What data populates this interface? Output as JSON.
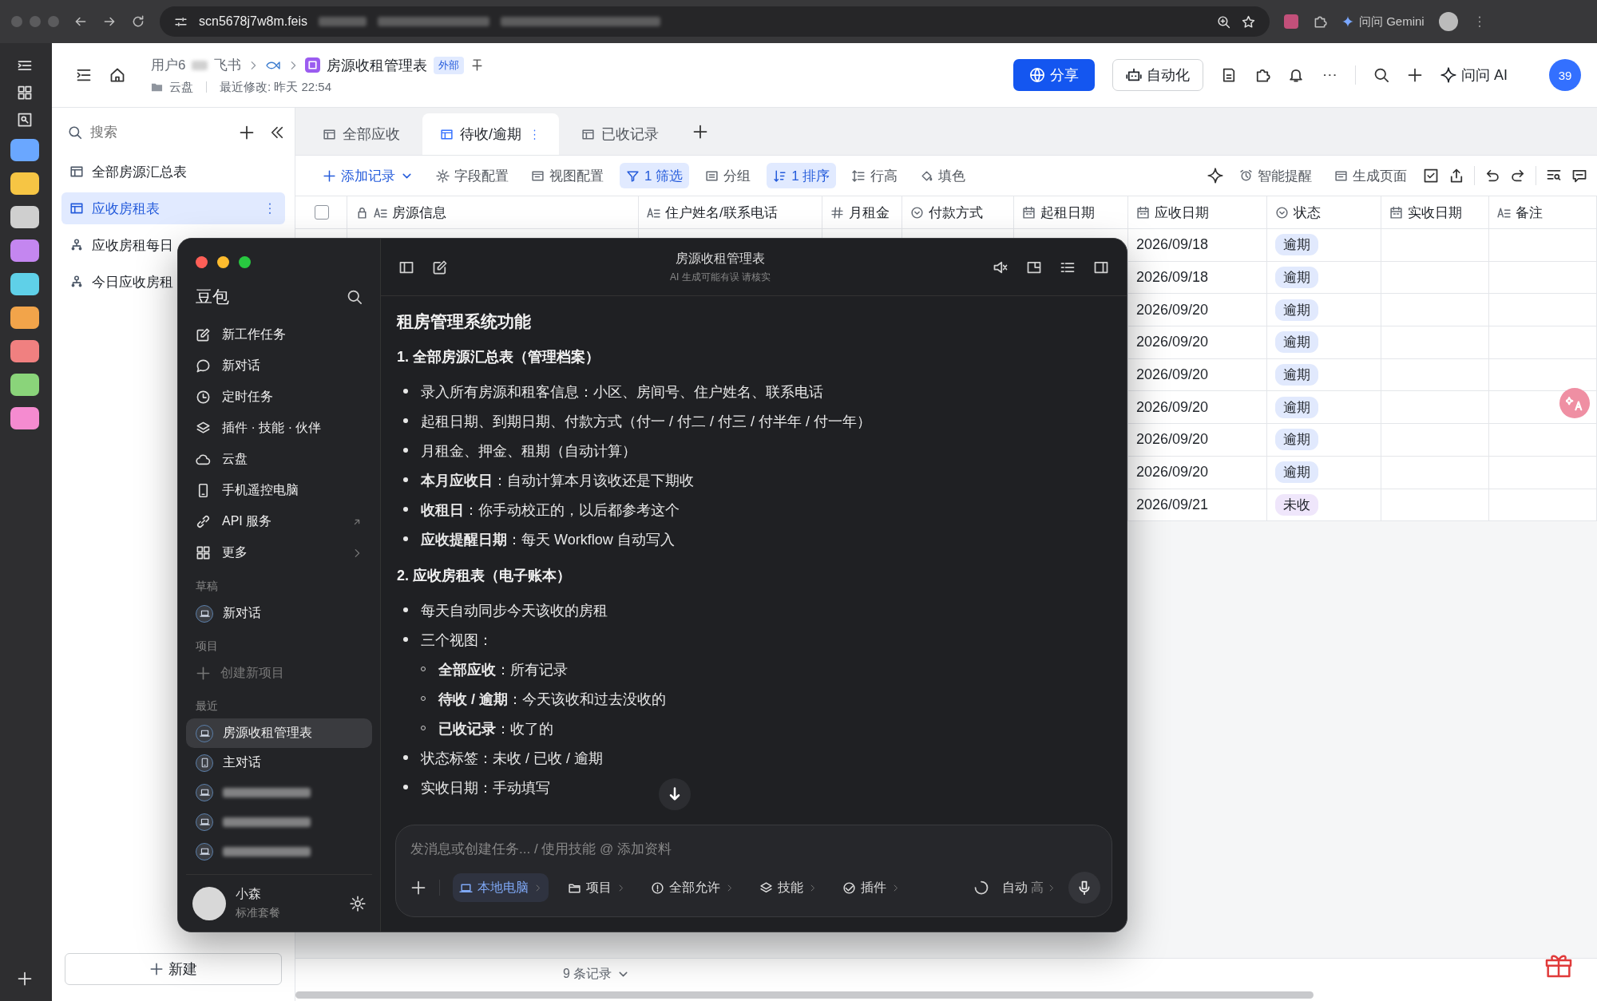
{
  "browser": {
    "url": "scn5678j7w8m.feis",
    "assistant_label": "问问 Gemini"
  },
  "header": {
    "breadcrumb": [
      "用户6",
      "飞书"
    ],
    "title": "房源收租管理表",
    "badge": "外部",
    "location": "云盘",
    "modified": "最近修改: 昨天 22:54",
    "share": "分享",
    "automation": "自动化",
    "ask_ai": "问问 AI",
    "avatar": "39"
  },
  "sidebar": {
    "search_placeholder": "搜索",
    "items": [
      {
        "label": "全部房源汇总表",
        "kind": "table",
        "selected": false
      },
      {
        "label": "应收房租表",
        "kind": "table",
        "selected": true
      },
      {
        "label": "应收房租每日",
        "kind": "flow",
        "selected": false
      },
      {
        "label": "今日应收房租",
        "kind": "flow",
        "selected": false
      }
    ],
    "new_button": "新建"
  },
  "tabs": [
    {
      "label": "全部应收",
      "selected": false
    },
    {
      "label": "待收/逾期",
      "selected": true
    },
    {
      "label": "已收记录",
      "selected": false
    }
  ],
  "toolbar": [
    {
      "label": "添加记录",
      "kind": "add",
      "active": false
    },
    {
      "label": "字段配置",
      "kind": "gear",
      "active": false
    },
    {
      "label": "视图配置",
      "kind": "view",
      "active": false
    },
    {
      "label": "1 筛选",
      "kind": "filter",
      "active": true
    },
    {
      "label": "分组",
      "kind": "group",
      "active": false
    },
    {
      "label": "1 排序",
      "kind": "sort",
      "active": true
    },
    {
      "label": "行高",
      "kind": "height",
      "active": false
    },
    {
      "label": "填色",
      "kind": "fill",
      "active": false
    }
  ],
  "toolbar_right": [
    {
      "label": "智能提醒",
      "kind": "bell"
    },
    {
      "label": "生成页面",
      "kind": "view"
    }
  ],
  "table": {
    "all_selected": false,
    "columns": [
      {
        "label": "房源信息",
        "kind": "text",
        "locked": true
      },
      {
        "label": "住户姓名/联系电话",
        "kind": "text",
        "locked": false
      },
      {
        "label": "月租金",
        "kind": "number",
        "locked": false
      },
      {
        "label": "付款方式",
        "kind": "option",
        "locked": false
      },
      {
        "label": "起租日期",
        "kind": "date",
        "locked": false
      },
      {
        "label": "应收日期",
        "kind": "date",
        "locked": false
      },
      {
        "label": "状态",
        "kind": "option",
        "locked": false
      },
      {
        "label": "实收日期",
        "kind": "date",
        "locked": false
      },
      {
        "label": "备注",
        "kind": "text",
        "locked": false
      }
    ],
    "rows": [
      {
        "due_date": "2026/09/18",
        "status": "逾期",
        "color": "#e1e9fd"
      },
      {
        "due_date": "2026/09/18",
        "status": "逾期",
        "color": "#e1e9fd"
      },
      {
        "due_date": "2026/09/20",
        "status": "逾期",
        "color": "#e1e9fd"
      },
      {
        "due_date": "2026/09/20",
        "status": "逾期",
        "color": "#e1e9fd"
      },
      {
        "due_date": "2026/09/20",
        "status": "逾期",
        "color": "#e1e9fd"
      },
      {
        "due_date": "2026/09/20",
        "status": "逾期",
        "color": "#e1e9fd"
      },
      {
        "due_date": "2026/09/20",
        "status": "逾期",
        "color": "#e1e9fd"
      },
      {
        "due_date": "2026/09/20",
        "status": "逾期",
        "color": "#e1e9fd"
      },
      {
        "due_date": "2026/09/21",
        "status": "未收",
        "color": "#efe6fb"
      }
    ],
    "footer": "9 条记录"
  },
  "assistant": {
    "app_name": "豆包",
    "menu": [
      {
        "label": "新工作任务",
        "kind": "edit",
        "external": false,
        "submenu": false
      },
      {
        "label": "新对话",
        "kind": "chat",
        "external": false,
        "submenu": false
      },
      {
        "label": "定时任务",
        "kind": "clock",
        "external": false,
        "submenu": false
      },
      {
        "label": "插件 · 技能 · 伙伴",
        "kind": "layers",
        "external": false,
        "submenu": false
      },
      {
        "label": "云盘",
        "kind": "cloud",
        "external": false,
        "submenu": false
      },
      {
        "label": "手机遥控电脑",
        "kind": "phone",
        "external": false,
        "submenu": false
      },
      {
        "label": "API 服务",
        "kind": "link",
        "external": true,
        "submenu": false
      },
      {
        "label": "更多",
        "kind": "grid",
        "external": false,
        "submenu": true
      }
    ],
    "sections": [
      {
        "title": "草稿",
        "items": [
          {
            "label": "新对话",
            "kind": "laptop",
            "selected": false
          }
        ]
      },
      {
        "title": "项目",
        "items": [
          {
            "label": "创建新项目",
            "kind": "add",
            "selected": false
          }
        ]
      },
      {
        "title": "最近",
        "items": [
          {
            "label": "房源收租管理表",
            "kind": "laptop",
            "selected": true
          },
          {
            "label": "主对话",
            "kind": "phone",
            "selected": false
          }
        ]
      }
    ],
    "user": {
      "name": "小森",
      "plan": "标准套餐"
    },
    "chat_title": "房源收租管理表",
    "chat_subtitle": "AI 生成可能有误 请核实",
    "message": {
      "heading": "租房管理系统功能",
      "sections": [
        {
          "title": "1. 全部房源汇总表（管理档案）",
          "bullets": [
            {
              "text": "录入所有房源和租客信息：小区、房间号、住户姓名、联系电话"
            },
            {
              "text": "起租日期、到期日期、付款方式（付一 / 付二 / 付三 / 付半年 / 付一年）"
            },
            {
              "text": "月租金、押金、租期（自动计算）"
            },
            {
              "text": "**本月应收日**：自动计算本月该收还是下期收"
            },
            {
              "text": "**收租日**：你手动校正的，以后都参考这个"
            },
            {
              "text": "**应收提醒日期**：每天 Workflow 自动写入"
            }
          ]
        },
        {
          "title": "2. 应收房租表（电子账本）",
          "bullets": [
            {
              "text": "每天自动同步今天该收的房租"
            },
            {
              "text": "三个视图：",
              "children": [
                {
                  "text": "**全部应收**：所有记录"
                },
                {
                  "text": "**待收 / 逾期**：今天该收和过去没收的"
                },
                {
                  "text": "**已收记录**：收了的"
                }
              ]
            },
            {
              "text": "状态标签：未收 / 已收 / 逾期"
            },
            {
              "text": "实收日期：手动填写"
            }
          ]
        }
      ]
    },
    "composer": {
      "placeholder": "发消息或创建任务... / 使用技能 @ 添加资料",
      "chips": [
        {
          "label": "本地电脑",
          "kind": "laptop",
          "selected": true
        },
        {
          "label": "项目",
          "kind": "folder",
          "selected": false
        },
        {
          "label": "全部允许",
          "kind": "alert",
          "selected": false
        },
        {
          "label": "技能",
          "kind": "layers",
          "selected": false
        },
        {
          "label": "插件",
          "kind": "plugin",
          "selected": false
        }
      ],
      "mode": "自动",
      "level": "高"
    }
  }
}
